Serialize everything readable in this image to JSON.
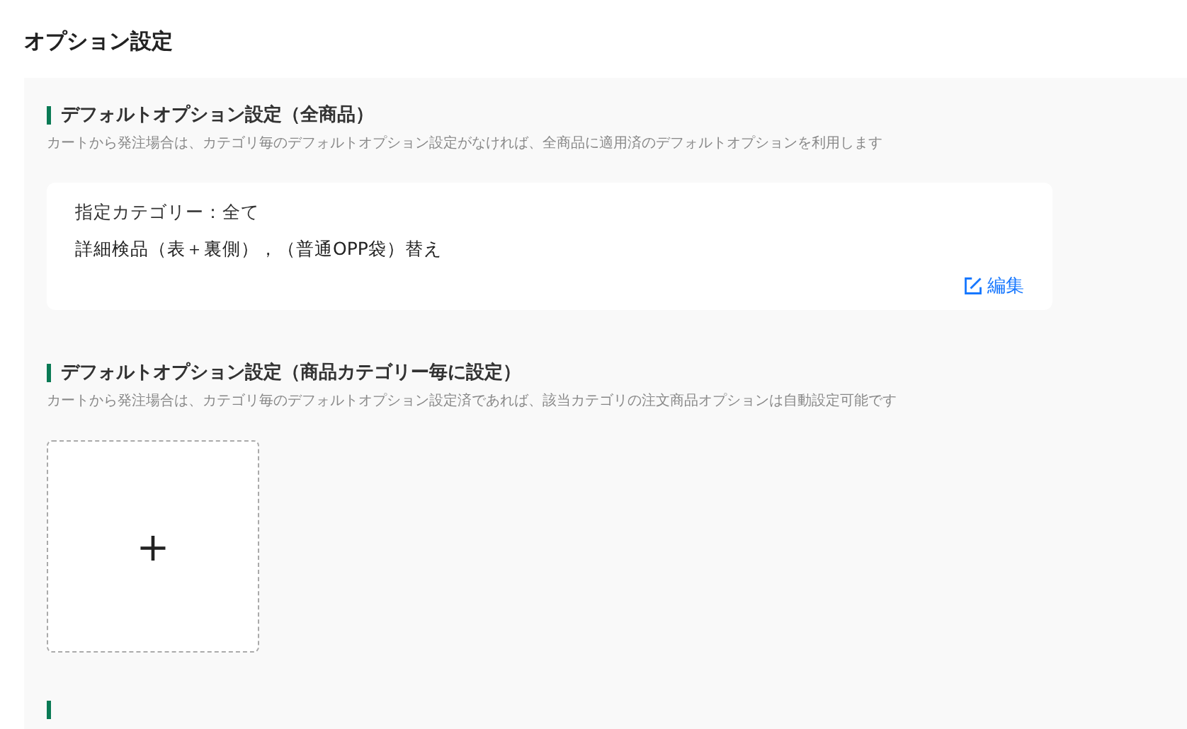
{
  "page_title": "オプション設定",
  "sections": [
    {
      "kind": "card",
      "title": "デフォルトオプション設定（全商品）",
      "description": "カートから発注場合は、カテゴリ毎のデフォルトオプション設定がなければ、全商品に適用済のデフォルトオプションを利用します",
      "card": {
        "category": "指定カテゴリー：全て",
        "options": "詳細検品（表＋裏側），（普通OPP袋）替え",
        "edit_label": "編集"
      }
    },
    {
      "kind": "add",
      "title": "デフォルトオプション設定（商品カテゴリー毎に設定）",
      "description": "カートから発注場合は、カテゴリ毎のデフォルトオプション設定済であれば、該当カテゴリの注文商品オプションは自動設定可能です",
      "add_label": "+"
    },
    {
      "kind": "cut"
    }
  ]
}
